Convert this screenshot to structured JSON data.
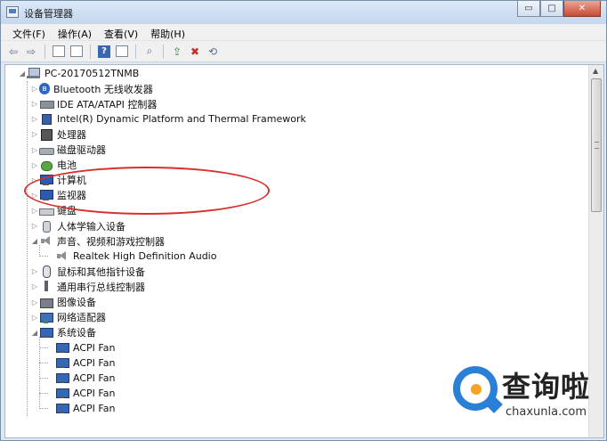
{
  "window": {
    "title": "设备管理器",
    "controls": {
      "minimize": "▭",
      "maximize": "□",
      "close": "✕"
    }
  },
  "menu": [
    "文件(F)",
    "操作(A)",
    "查看(V)",
    "帮助(H)"
  ],
  "toolbar": {
    "icons": [
      "back-arrow-icon",
      "forward-arrow-icon",
      "properties-icon",
      "show-hidden-icon",
      "help-icon",
      "view-icon",
      "scan-hardware-icon",
      "update-driver-icon",
      "disable-device-icon",
      "uninstall-device-icon"
    ]
  },
  "tree": {
    "root": "PC-20170512TNMB",
    "categories": [
      {
        "label": "Bluetooth 无线收发器",
        "icon": "bluetooth-icon",
        "expanded": false
      },
      {
        "label": "IDE ATA/ATAPI 控制器",
        "icon": "ide-icon",
        "expanded": false
      },
      {
        "label": "Intel(R) Dynamic Platform and Thermal Framework",
        "icon": "intel-icon",
        "expanded": false
      },
      {
        "label": "处理器",
        "icon": "processor-icon",
        "expanded": false
      },
      {
        "label": "磁盘驱动器",
        "icon": "disk-icon",
        "expanded": false
      },
      {
        "label": "电池",
        "icon": "battery-icon",
        "expanded": false
      },
      {
        "label": "计算机",
        "icon": "computer-icon",
        "expanded": false
      },
      {
        "label": "监视器",
        "icon": "monitor-icon",
        "expanded": false
      },
      {
        "label": "键盘",
        "icon": "keyboard-icon",
        "expanded": false
      },
      {
        "label": "人体学输入设备",
        "icon": "hid-icon",
        "expanded": false
      },
      {
        "label": "声音、视频和游戏控制器",
        "icon": "sound-icon",
        "expanded": true,
        "children": [
          "Realtek High Definition Audio"
        ]
      },
      {
        "label": "鼠标和其他指针设备",
        "icon": "mouse-icon",
        "expanded": false
      },
      {
        "label": "通用串行总线控制器",
        "icon": "usb-icon",
        "expanded": false
      },
      {
        "label": "图像设备",
        "icon": "imaging-icon",
        "expanded": false
      },
      {
        "label": "网络适配器",
        "icon": "network-icon",
        "expanded": false
      },
      {
        "label": "系统设备",
        "icon": "system-icon",
        "expanded": true,
        "children": [
          "ACPI Fan",
          "ACPI Fan",
          "ACPI Fan",
          "ACPI Fan",
          "ACPI Fan"
        ]
      }
    ]
  },
  "annotation": {
    "color": "#d9302c",
    "target": "Realtek High Definition Audio"
  },
  "watermark": {
    "text": "查询啦",
    "url": "chaxunla.com"
  },
  "colors": {
    "accent": "#2a7fd7",
    "accent2": "#f4a322",
    "annotation": "#d9302c"
  }
}
